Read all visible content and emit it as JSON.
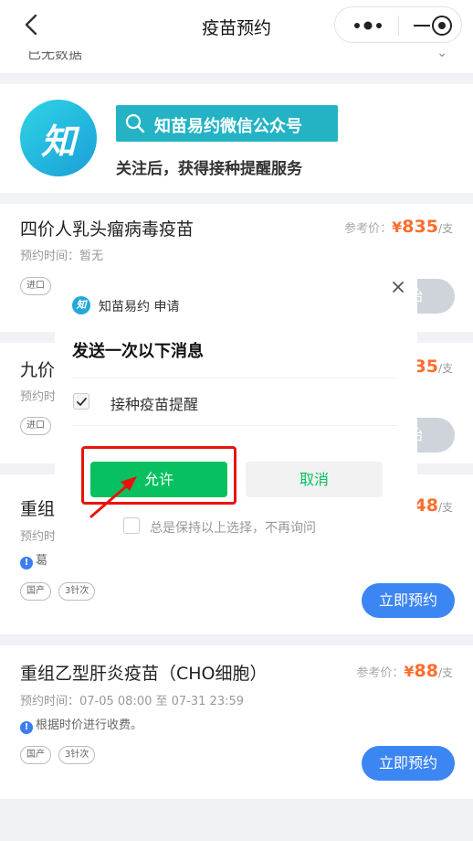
{
  "navbar": {
    "title": "疫苗预约"
  },
  "cut_row": {
    "text": "已无数据"
  },
  "banner": {
    "wx_label": "知苗易约微信公众号",
    "subtitle": "关注后，获得接种提醒服务",
    "logo_text": "知"
  },
  "cards": [
    {
      "title": "四价人乳头瘤病毒疫苗",
      "ref_label": "参考价：",
      "yen": "¥",
      "price": "835",
      "unit": "/支",
      "time": "预约时间：暂无",
      "tags": [
        "进口"
      ],
      "button": "开始"
    },
    {
      "title": "九价",
      "ref_label": "",
      "yen": "",
      "price": "35",
      "unit": "/支",
      "time": "预约时",
      "tags": [
        "进口"
      ],
      "button": "开始"
    },
    {
      "title": "重组",
      "ref_label": "",
      "yen": "",
      "price": "48",
      "unit": "/支",
      "time": "预约时",
      "note": "葛",
      "tags": [
        "国产",
        "3针次"
      ],
      "button": "立即预约"
    },
    {
      "title": "重组乙型肝炎疫苗（CHO细胞）",
      "ref_label": "参考价：",
      "yen": "¥",
      "price": "88",
      "unit": "/支",
      "time": "预约时间：07-05 08:00 至 07-31 23:59",
      "note": "根据时价进行收费。",
      "tags": [
        "国产",
        "3针次"
      ],
      "button": "立即预约"
    }
  ],
  "dialog": {
    "logo_text": "知",
    "app": "知苗易约  申请",
    "title": "发送一次以下消息",
    "item": "接种疫苗提醒",
    "item_checked": true,
    "allow": "允许",
    "cancel": "取消",
    "remember": "总是保持以上选择，不再询问",
    "remember_checked": false
  },
  "colors": {
    "accent_blue": "#3c86f3",
    "price_orange": "#fe6d2c",
    "wechat_green": "#07c160",
    "highlight_red": "#e8140c",
    "banner_teal": "#23b3c5"
  }
}
